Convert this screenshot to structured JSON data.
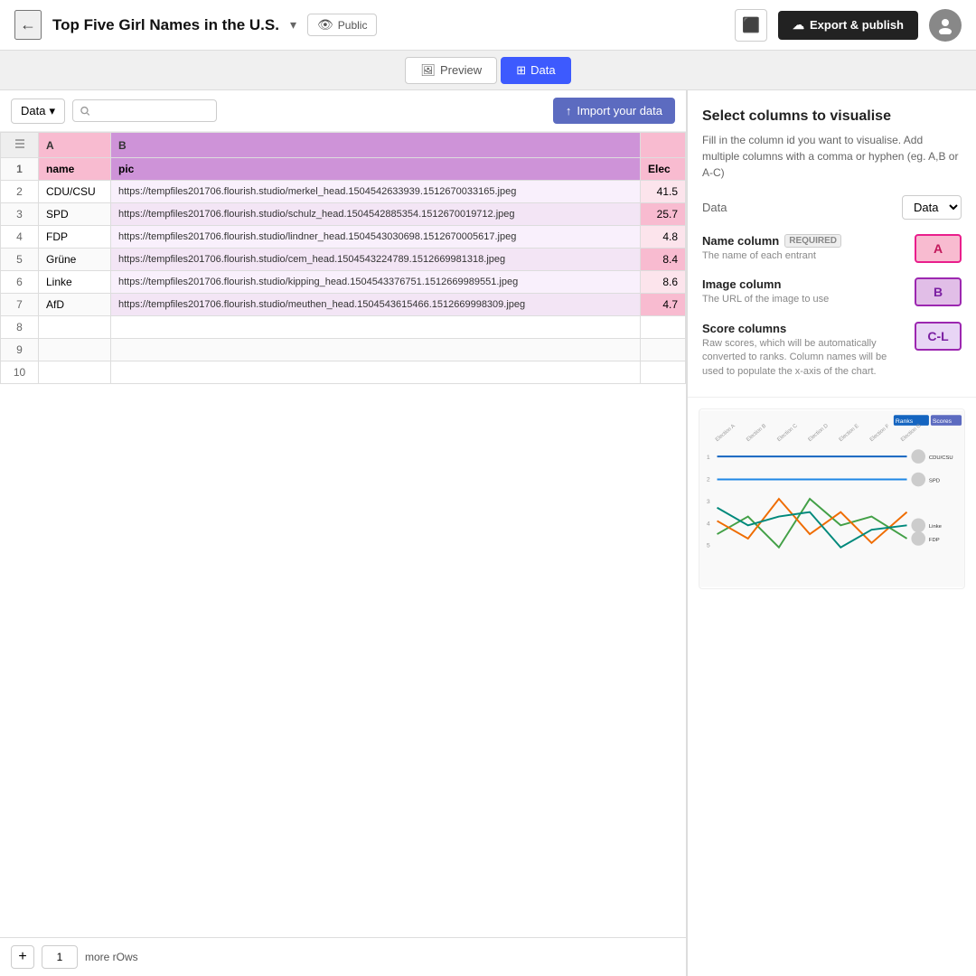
{
  "topbar": {
    "back_icon": "←",
    "title": "Top Five Girl Names in the U.S.",
    "dropdown_icon": "▾",
    "public_label": "Public",
    "eye_icon": "👁",
    "square_icon": "■",
    "export_label": "Export & publish",
    "upload_icon": "↑"
  },
  "tabs": [
    {
      "label": "Preview",
      "icon": "🖼",
      "active": false
    },
    {
      "label": "Data",
      "icon": "☰",
      "active": true
    }
  ],
  "toolbar": {
    "data_label": "Data",
    "dropdown_icon": "▾",
    "search_placeholder": "",
    "import_label": "Import your data",
    "import_icon": "↑"
  },
  "table": {
    "columns": [
      {
        "id": "num",
        "label": ""
      },
      {
        "id": "A",
        "label": "A"
      },
      {
        "id": "B",
        "label": "B"
      },
      {
        "id": "C",
        "label": ""
      }
    ],
    "header_row": {
      "num": "1",
      "A": "name",
      "B": "pic",
      "C": "Elec"
    },
    "rows": [
      {
        "num": "2",
        "A": "CDU/CSU",
        "B": "https://tempfiles201706.flourish.studio/merkel_head.1504542633939.1512670033165.jpeg",
        "C": "41.5"
      },
      {
        "num": "3",
        "A": "SPD",
        "B": "https://tempfiles201706.flourish.studio/schulz_head.1504542885354.1512670019712.jpeg",
        "C": "25.7"
      },
      {
        "num": "4",
        "A": "FDP",
        "B": "https://tempfiles201706.flourish.studio/lindner_head.1504543030698.1512670005617.jpeg",
        "C": "4.8"
      },
      {
        "num": "5",
        "A": "Grüne",
        "B": "https://tempfiles201706.flourish.studio/cem_head.1504543224789.1512669981318.jpeg",
        "C": "8.4"
      },
      {
        "num": "6",
        "A": "Linke",
        "B": "https://tempfiles201706.flourish.studio/kipping_head.1504543376751.1512669989551.jpeg",
        "C": "8.6"
      },
      {
        "num": "7",
        "A": "AfD",
        "B": "https://tempfiles201706.flourish.studio/meuthen_head.1504543615466.1512669998309.jpeg",
        "C": "4.7"
      },
      {
        "num": "8",
        "A": "",
        "B": "",
        "C": ""
      },
      {
        "num": "9",
        "A": "",
        "B": "",
        "C": ""
      },
      {
        "num": "10",
        "A": "",
        "B": "",
        "C": ""
      }
    ]
  },
  "bottom_bar": {
    "add_icon": "+",
    "row_count": "1",
    "more_rows_label": "more rOws"
  },
  "right_panel": {
    "title": "Select columns to visualise",
    "description": "Fill in the column id you want to visualise. Add multiple columns with a comma or hyphen (eg. A,B or A-C)",
    "data_label": "Data",
    "data_select": "Data",
    "columns": [
      {
        "name": "Name column",
        "required": true,
        "required_label": "REQUIRED",
        "desc": "The name of each entrant",
        "tag": "A",
        "tag_color": "pink"
      },
      {
        "name": "Image column",
        "required": false,
        "desc": "The URL of the image to use",
        "tag": "B",
        "tag_color": "purple"
      },
      {
        "name": "Score columns",
        "required": false,
        "desc": "Raw scores, which will be automatically converted to ranks. Column names will be used to populate the x-axis of the chart.",
        "tag": "C-L",
        "tag_color": "purple2"
      }
    ]
  }
}
